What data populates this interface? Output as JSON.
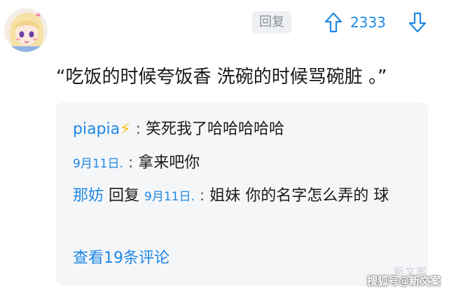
{
  "comment": {
    "reply_label": "回复",
    "score": "2333",
    "text": "“吃饭的时候夸饭香 洗碗的时候骂碗脏 。”"
  },
  "replies": [
    {
      "author": "piapia",
      "author_suffix": "⚡",
      "separator": " : ",
      "text": "笑死我了哈哈哈哈哈"
    },
    {
      "author": "9月11日.",
      "separator": " : ",
      "text": "拿来吧你"
    },
    {
      "author": "那妨",
      "reply_word": "回复",
      "reply_to": "9月11日.",
      "separator": " : ",
      "text": "姐妹 你的名字怎么弄的 球"
    }
  ],
  "view_more": "查看19条评论",
  "watermark": "搜狐号@新文案",
  "watermark_faint": "新文案",
  "colors": {
    "accent": "#1e88e5",
    "reply_box_bg": "#f5f6f8"
  },
  "icons": [
    "avatar",
    "upvote-arrow-icon",
    "downvote-arrow-icon",
    "lightning-icon"
  ]
}
